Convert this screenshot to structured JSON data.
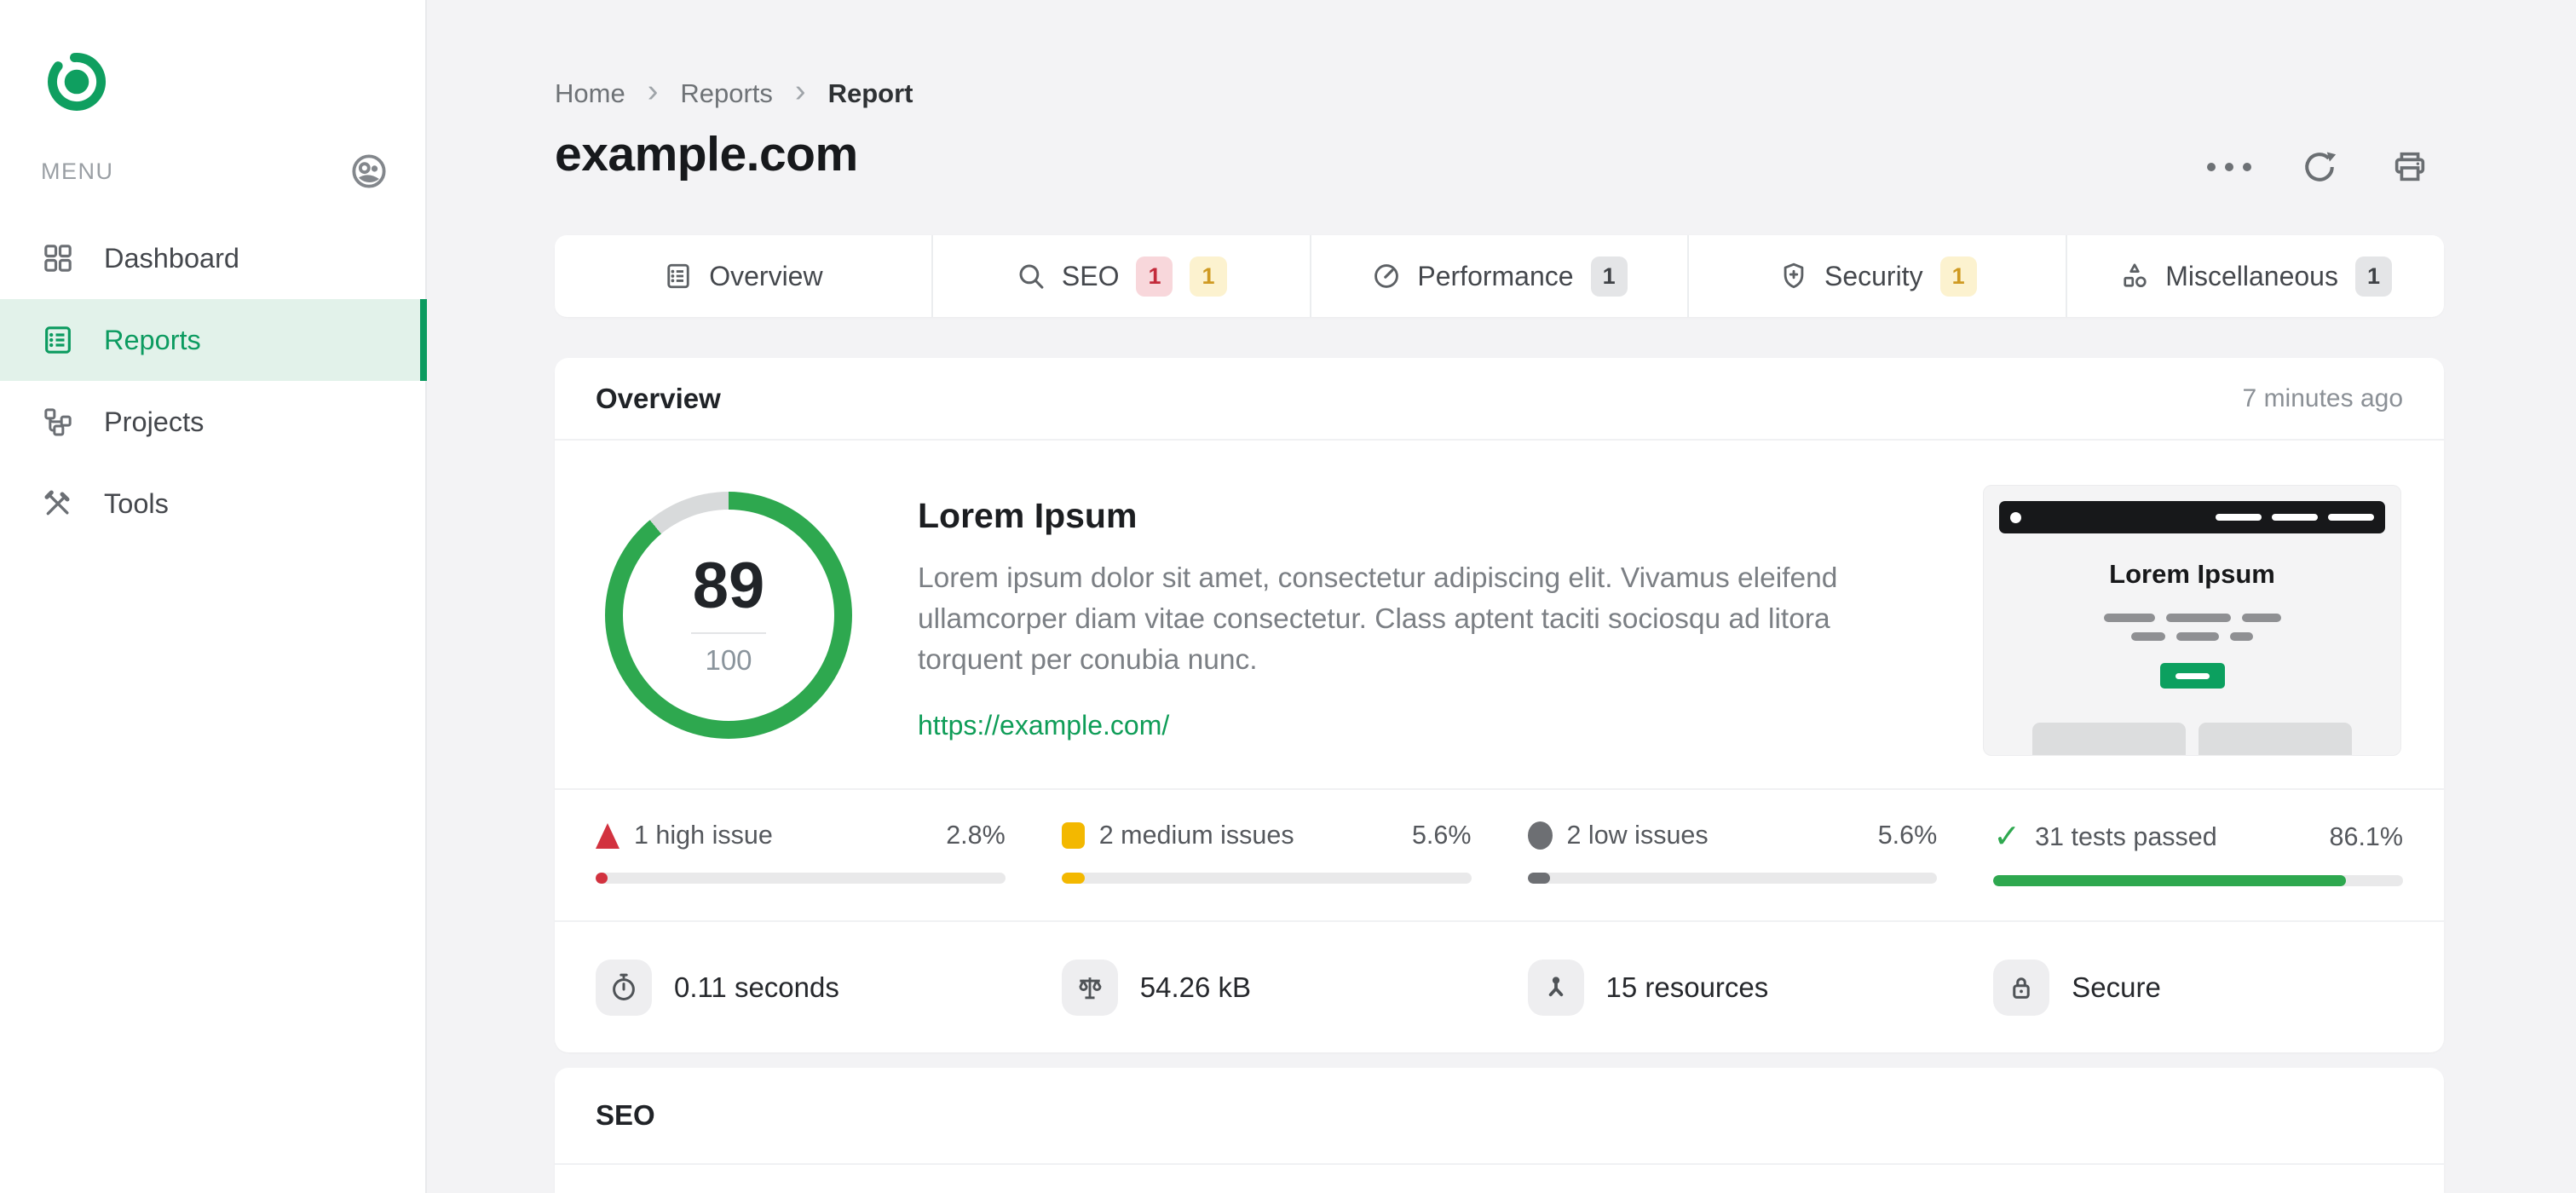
{
  "sidebar": {
    "menu_label": "MENU",
    "items": [
      {
        "label": "Dashboard"
      },
      {
        "label": "Reports"
      },
      {
        "label": "Projects"
      },
      {
        "label": "Tools"
      }
    ]
  },
  "breadcrumb": {
    "items": [
      "Home",
      "Reports",
      "Report"
    ]
  },
  "header": {
    "title": "example.com"
  },
  "tabs": [
    {
      "label": "Overview"
    },
    {
      "label": "SEO",
      "badge1": "1",
      "badge2": "1"
    },
    {
      "label": "Performance",
      "badge1": "1"
    },
    {
      "label": "Security",
      "badge1": "1"
    },
    {
      "label": "Miscellaneous",
      "badge1": "1"
    }
  ],
  "overview": {
    "title": "Overview",
    "updated": "7 minutes ago",
    "score": {
      "value": "89",
      "max": "100",
      "percent": 89
    },
    "site": {
      "heading": "Lorem Ipsum",
      "description": "Lorem ipsum dolor sit amet, consectetur adipiscing elit. Vivamus eleifend ullamcorper diam vitae consectetur. Class aptent taciti sociosqu ad litora torquent per conubia nunc.",
      "url": "https://example.com/"
    },
    "thumbnail": {
      "heading": "Lorem Ipsum"
    },
    "stats": [
      {
        "label": "1 high issue",
        "percent": "2.8%",
        "fill": 2.8
      },
      {
        "label": "2 medium issues",
        "percent": "5.6%",
        "fill": 5.6
      },
      {
        "label": "2 low issues",
        "percent": "5.6%",
        "fill": 5.6
      },
      {
        "label": "31 tests passed",
        "percent": "86.1%",
        "fill": 86.1
      }
    ],
    "metrics": [
      {
        "label": "0.11 seconds"
      },
      {
        "label": "54.26 kB"
      },
      {
        "label": "15 resources"
      },
      {
        "label": "Secure"
      }
    ]
  },
  "seo": {
    "title": "SEO"
  },
  "colors": {
    "accent": "#0f9d58",
    "ring_green": "#2ea84f",
    "ring_rest": "#d8dadb",
    "danger": "#d2323f",
    "warning": "#f3b800",
    "neutral": "#6d6f73"
  }
}
